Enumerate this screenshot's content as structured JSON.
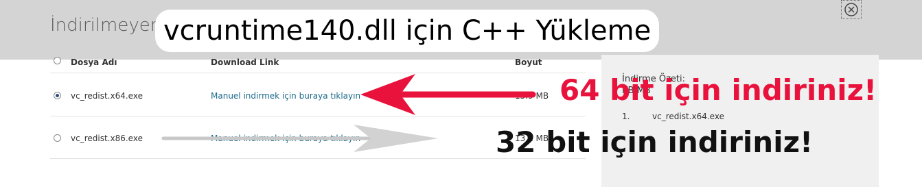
{
  "dialog": {
    "title": "İndirilmeyen",
    "close_icon": "close-circle-icon"
  },
  "banner": {
    "text": "vcruntime140.dll için C++ Yükleme"
  },
  "table": {
    "headers": [
      "Dosya Adı",
      "Download Link",
      "Boyut"
    ],
    "rows": [
      {
        "file": "vc_redist.x64.exe",
        "link": "Manuel indirmek için buraya tıklayın",
        "size": "13.9 MB",
        "selected": true
      },
      {
        "file": "vc_redist.x86.exe",
        "link": "Manuel indirmek için buraya tıklayın",
        "size": "13.2 MB",
        "selected": false
      }
    ]
  },
  "summary": {
    "title": "İndirme Özeti:",
    "subtitle": "KB MB",
    "items": [
      {
        "num": "1.",
        "name": "vc_redist.x64.exe"
      }
    ]
  },
  "annotations": {
    "red_text": "64 bit için indiriniz!",
    "black_text": "32 bit için indiriniz!",
    "red_color": "#e8123c",
    "black_color": "#111111"
  },
  "colors": {
    "header_band": "#d4d4d4",
    "link": "#1a6a8a",
    "panel": "#f0f0f0"
  }
}
